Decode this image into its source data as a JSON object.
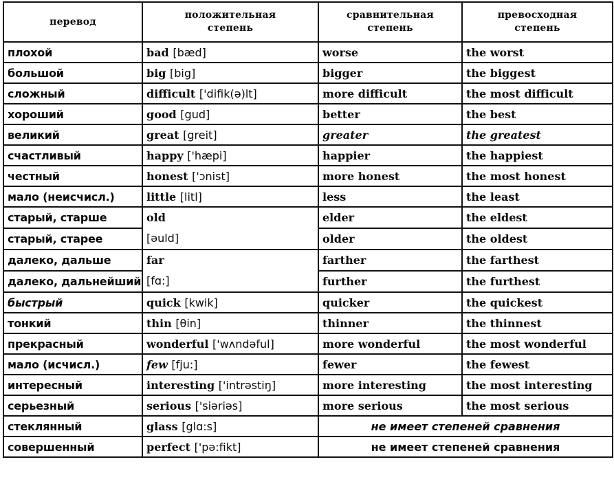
{
  "table": {
    "headers": [
      "перевод",
      "положительная степень",
      "сравнительная степень",
      "превосходная степень"
    ],
    "rows": [
      {
        "ru": "плохой",
        "word": "bad",
        "transcription": "[bæd]",
        "comparative": "worse",
        "superlative": "the worst"
      },
      {
        "ru": "большой",
        "word": "big",
        "transcription": "[big]",
        "comparative": "bigger",
        "superlative": "the biggest"
      },
      {
        "ru": "сложный",
        "word": "difficult",
        "transcription": "['difik(ə)lt]",
        "comparative": "more difficult",
        "superlative": "the most difficult"
      },
      {
        "ru": "хороший",
        "word": "good",
        "transcription": "[gud]",
        "comparative": "better",
        "superlative": "the best"
      },
      {
        "ru": "великий",
        "word": "great",
        "transcription": "[greit]",
        "comparative": "greater",
        "superlative": "the greatest"
      },
      {
        "ru": "счастливый",
        "word": "happy",
        "transcription": "['hæpi]",
        "comparative": "happier",
        "superlative": "the happiest"
      },
      {
        "ru": "честный",
        "word": "honest",
        "transcription": "['ɔnist]",
        "comparative": "more honest",
        "superlative": "the most honest"
      },
      {
        "ru": "мало (неисчисл.)",
        "word": "little",
        "transcription": "[litl]",
        "comparative": "less",
        "superlative": "the least"
      },
      {
        "ru": "старый, старше",
        "word": "old",
        "transcription": "",
        "comparative": "elder",
        "superlative": "the eldest"
      },
      {
        "ru": "старый, старее",
        "word": "",
        "transcription": "[əuld]",
        "comparative": "older",
        "superlative": "the oldest"
      },
      {
        "ru": "далеко, дальше",
        "word": "far",
        "transcription": "",
        "comparative": "farther",
        "superlative": "the farthest"
      },
      {
        "ru": "далеко, дальнейший",
        "word": "",
        "transcription": "[fɑ:]",
        "comparative": "further",
        "superlative": "the furthest"
      },
      {
        "ru": "быстрый",
        "word": "quick",
        "transcription": "[kwik]",
        "comparative": "quicker",
        "superlative": "the quickest"
      },
      {
        "ru": "тонкий",
        "word": "thin",
        "transcription": "[θin]",
        "comparative": "thinner",
        "superlative": "the thinnest"
      },
      {
        "ru": "прекрасный",
        "word": "wonderful",
        "transcription": "['wʌndəful]",
        "comparative": "more wonderful",
        "superlative": "the most wonderful"
      },
      {
        "ru": "мало (исчисл.)",
        "word": "few",
        "transcription": "[fju:]",
        "comparative": "fewer",
        "superlative": "the fewest"
      },
      {
        "ru": "интересный",
        "word": "interesting",
        "transcription": "['intrəstiŋ]",
        "comparative": "more interesting",
        "superlative": "the most interesting"
      },
      {
        "ru": "серьезный",
        "word": "serious",
        "transcription": "['siəriəs]",
        "comparative": "more serious",
        "superlative": "the most serious"
      },
      {
        "ru": "стеклянный",
        "word": "glass",
        "transcription": "[glɑ:s]",
        "no_degrees": "не имеет степеней сравнения"
      },
      {
        "ru": "совершенный",
        "word": "perfect",
        "transcription": "['pə:fikt]",
        "no_degrees": "не имеет степеней сравнения"
      }
    ]
  }
}
